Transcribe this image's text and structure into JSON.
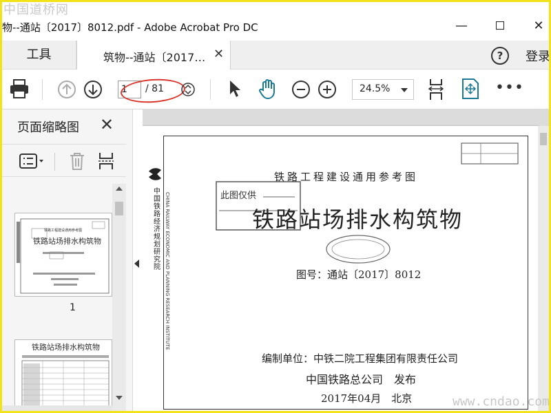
{
  "watermark_top": "中国道桥网",
  "watermark_bottom": "www.cndao.com",
  "window": {
    "title": "物--通站〔2017〕8012.pdf - Adobe Acrobat Pro DC"
  },
  "tabs": {
    "tools_label": "工具",
    "doc_label": "筑物--通站〔2017…",
    "login_label": "登录"
  },
  "toolbar": {
    "page_current": "1",
    "page_total": "/ 81",
    "zoom": "24.5%"
  },
  "left_pane": {
    "title": "页面缩略图",
    "thumb1_label": "1"
  },
  "document": {
    "series_title": "铁路工程建设通用参考图",
    "main_title": "铁路站场排水构筑物",
    "drawing_number": "图号：通站〔2017〕8012",
    "compiled_by": "编制单位：中铁二院工程集团有限责任公司",
    "published_by": "中国铁路总公司　发布",
    "date": "2017年04月　北京",
    "stamp_text": "此图仅供",
    "vertical_org": "中国铁路经济规划研究院",
    "vertical_org_en": "CHINA RAILWAY ECONOMIC AND PLANNING RESEARCH INSTITUTE"
  },
  "thumbs": {
    "thumb1_line1": "铁路工程建设通用参考图",
    "thumb1_line2": "铁路站场排水构筑物",
    "thumb2_title": "铁路站场排水构筑物"
  }
}
